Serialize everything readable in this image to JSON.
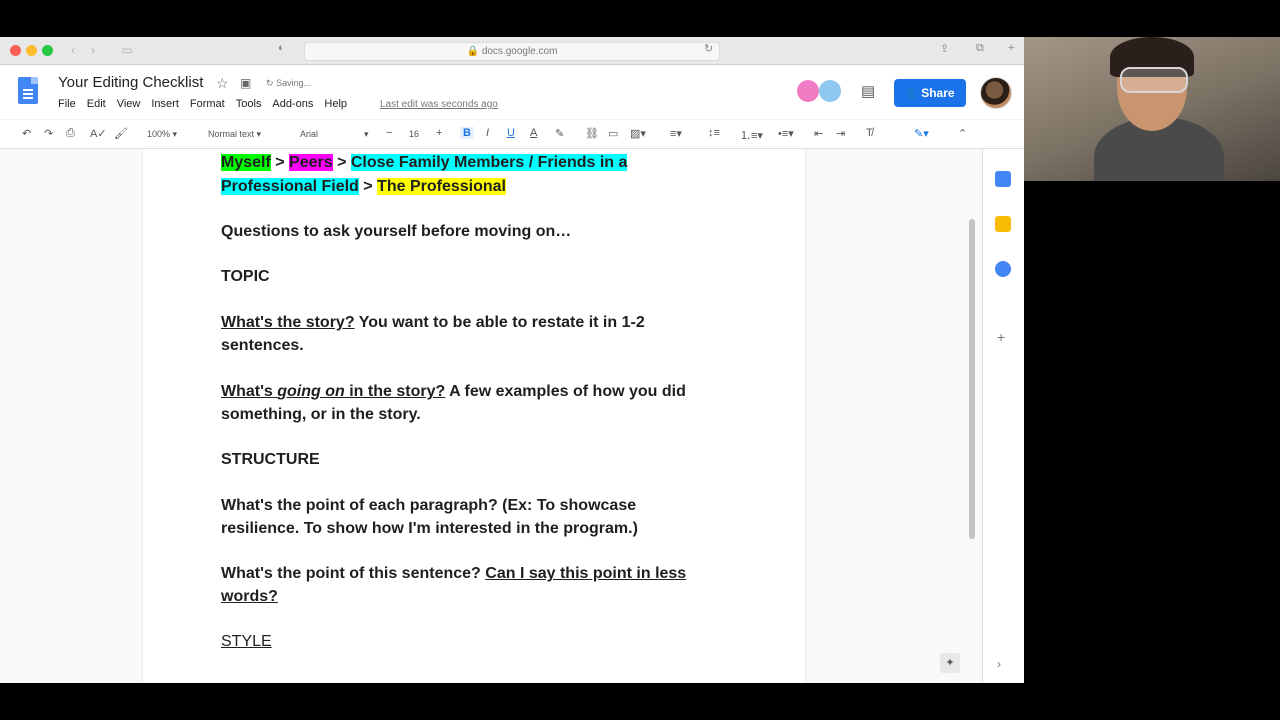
{
  "browser": {
    "url": "docs.google.com"
  },
  "doc": {
    "title": "Your Editing Checklist",
    "status": "Saving...",
    "last_edit": "Last edit was seconds ago",
    "menus": [
      "File",
      "Edit",
      "View",
      "Insert",
      "Format",
      "Tools",
      "Add-ons",
      "Help"
    ],
    "share_label": "Share"
  },
  "toolbar": {
    "zoom": "100%",
    "style": "Normal text",
    "font": "Arial",
    "font_size": "16"
  },
  "content": {
    "chain": {
      "myself": "Myself",
      "sep1": " > ",
      "peers": "Peers",
      "sep2": " > ",
      "close_family_line1": "Close Family Members / Friends in a",
      "close_family_line2": "Professional Field",
      "sep3": " > ",
      "professional": "The Professional"
    },
    "questions_intro": "Questions to ask yourself before moving on…",
    "topic_heading": "TOPIC",
    "q1_link": "What's the story?",
    "q1_rest_line1": " You want to be able to restate it in 1-2",
    "q1_rest_line2": "sentences.",
    "q2_part1": "What's ",
    "q2_italic": "going on",
    "q2_part2": " in the story?",
    "q2_rest_line1": "  A few examples of how you did",
    "q2_rest_line2": "something, or in the story.",
    "structure_heading": "STRUCTURE",
    "q3_line1": "What's the point of each paragraph? (Ex: To showcase",
    "q3_line2": "resilience. To show how I'm interested in the program.)",
    "q4_plain": "What's the point of this sentence? ",
    "q4_link_line1": "Can I say this point in less",
    "q4_link_line2": "words?",
    "style_heading": "STYLE"
  },
  "colors": {
    "share_blue": "#1a73e8",
    "highlight_green": "#00ff00",
    "highlight_magenta": "#ff00ff",
    "highlight_cyan": "#00ffff",
    "highlight_yellow": "#ffff00"
  }
}
